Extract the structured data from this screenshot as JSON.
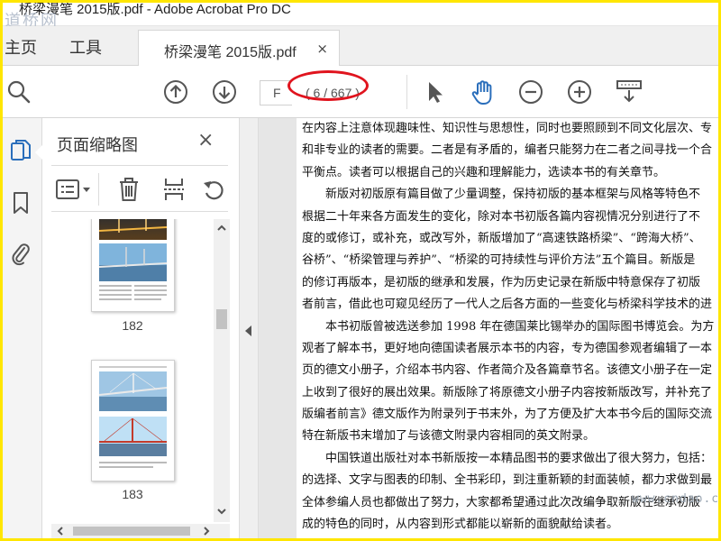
{
  "window": {
    "title": "桥梁漫笔 2015版.pdf - Adobe Acrobat Pro DC"
  },
  "watermarks": {
    "top_left": "道桥网",
    "bottom_right": "www.cndao.com"
  },
  "tabs": {
    "home": "主页",
    "tools": "工具",
    "document": "桥梁漫笔 2015版.pdf",
    "close_glyph": "×"
  },
  "toolbar": {
    "page_input_value": "F",
    "page_count": "( 6 / 667 )",
    "highlight_color": "#e0141e",
    "icons": [
      "search-icon",
      "page-up-icon",
      "page-down-icon",
      "select-cursor-icon",
      "hand-tool-icon",
      "zoom-out-icon",
      "zoom-in-icon",
      "page-display-icon"
    ]
  },
  "rail": {
    "icons": [
      "page-thumbnails-icon",
      "bookmark-icon",
      "attachment-icon"
    ],
    "active_color": "#2a6ebb"
  },
  "thumbnails_panel": {
    "title": "页面缩略图",
    "close_glyph": "×",
    "tools": [
      "thumbnail-options-icon",
      "delete-page-icon",
      "insert-page-icon",
      "rotate-page-icon"
    ],
    "pages": [
      {
        "label": "182"
      },
      {
        "label": "183"
      }
    ]
  },
  "document": {
    "lines": [
      {
        "text": "在内容上注意体现趣味性、知识性与思想性，同时也要照顾到不同文化层次、专",
        "indent": false
      },
      {
        "text": "和非专业的读者的需要。二者是有矛盾的，编者只能努力在二者之间寻找一个合",
        "indent": false
      },
      {
        "text": "平衡点。读者可以根据自己的兴趣和理解能力，选读本书的有关章节。",
        "indent": false
      },
      {
        "text": "新版对初版原有篇目做了少量调整，保持初版的基本框架与风格等特色不",
        "indent": true
      },
      {
        "text": "根据二十年来各方面发生的变化，除对本书初版各篇内容视情况分别进行了不",
        "indent": false
      },
      {
        "text": "度的或修订，或补充，或改写外，新版增加了“高速铁路桥梁”、“跨海大桥”、",
        "indent": false
      },
      {
        "text": "谷桥”、“桥梁管理与养护”、“桥梁的可持续性与评价方法”五个篇目。新版是",
        "indent": false
      },
      {
        "text": "的修订再版本，是初版的继承和发展，作为历史记录在新版中特意保存了初版",
        "indent": false
      },
      {
        "text": "者前言，借此也可窥见经历了一代人之后各方面的一些变化与桥梁科学技术的进",
        "indent": false
      },
      {
        "text": "本书初版曾被选送参加 1998 年在德国莱比锡举办的国际图书博览会。为方",
        "indent": true
      },
      {
        "text": "观者了解本书，更好地向德国读者展示本书的内容，专为德国参观者编辑了一本",
        "indent": false
      },
      {
        "text": "页的德文小册子，介绍本书内容、作者简介及各篇章节名。该德文小册子在一定",
        "indent": false
      },
      {
        "text": "上收到了很好的展出效果。新版除了将原德文小册子内容按新版改写，并补充了",
        "indent": false
      },
      {
        "text": "版编者前言》德文版作为附录列于书末外，为了方便及扩大本书今后的国际交流",
        "indent": false
      },
      {
        "text": "特在新版书末增加了与该德文附录内容相同的英文附录。",
        "indent": false
      },
      {
        "text": "中国铁道出版社对本书新版按一本精品图书的要求做出了很大努力，包括：",
        "indent": true
      },
      {
        "text": "的选择、文字与图表的印制、全书彩印，到注重新颖的封面装帧，都力求做到最",
        "indent": false
      },
      {
        "text": "全体参编人员也都做出了努力，大家都希望通过此次改编争取新版在继承初版",
        "indent": false
      },
      {
        "text": "成的特色的同时，从内容到形式都能以崭新的面貌献给读者。",
        "indent": false
      }
    ]
  }
}
